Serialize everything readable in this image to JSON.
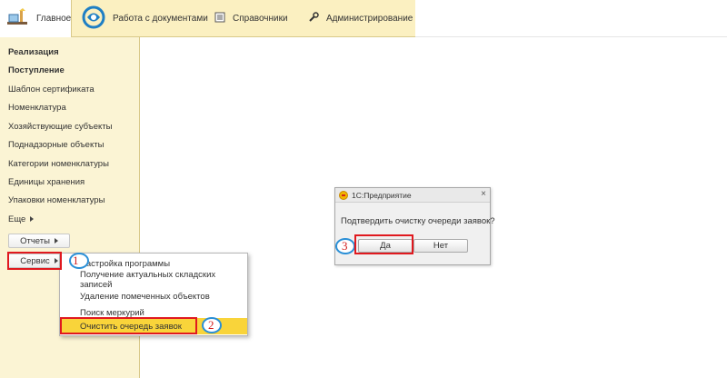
{
  "nav": {
    "items": [
      {
        "label": "Главное",
        "icon": "desk-icon"
      },
      {
        "label": "Работа с документами",
        "icon": "documents-swirl-icon"
      },
      {
        "label": "Справочники",
        "icon": "reference-book-icon"
      },
      {
        "label": "Администрирование",
        "icon": "wrench-icon"
      }
    ]
  },
  "sidebar": {
    "items": [
      {
        "label": "Реализация"
      },
      {
        "label": "Поступление"
      },
      {
        "label": "Шаблон сертификата"
      },
      {
        "label": "Номенклатура"
      },
      {
        "label": "Хозяйствующие субъекты"
      },
      {
        "label": "Поднадзорные объекты"
      },
      {
        "label": "Категории номенклатуры"
      },
      {
        "label": "Единицы хранения"
      },
      {
        "label": "Упаковки номенклатуры"
      },
      {
        "label": "Еще"
      }
    ],
    "reports_button": "Отчеты",
    "service_button": "Сервис"
  },
  "service_menu": {
    "items": [
      {
        "label": "Настройка программы"
      },
      {
        "label": "Получение актуальных складских записей"
      },
      {
        "label": "Удаление помеченных объектов"
      },
      {
        "label": "Поиск меркурий"
      },
      {
        "label": "Очистить очередь заявок"
      }
    ]
  },
  "dialog": {
    "title": "1С:Предприятие",
    "message": "Подтвердить очистку очереди заявок?",
    "yes": "Да",
    "no": "Нет",
    "close": "×"
  },
  "annotations": {
    "step1": "1",
    "step2": "2",
    "step3": "3",
    "color": "#e0191f",
    "circle_color": "#2a8fd6"
  },
  "colors": {
    "nav_bg": "#fbf0c1",
    "sidebar_bg": "#fbf4d4",
    "menu_highlight": "#f9d43a"
  }
}
